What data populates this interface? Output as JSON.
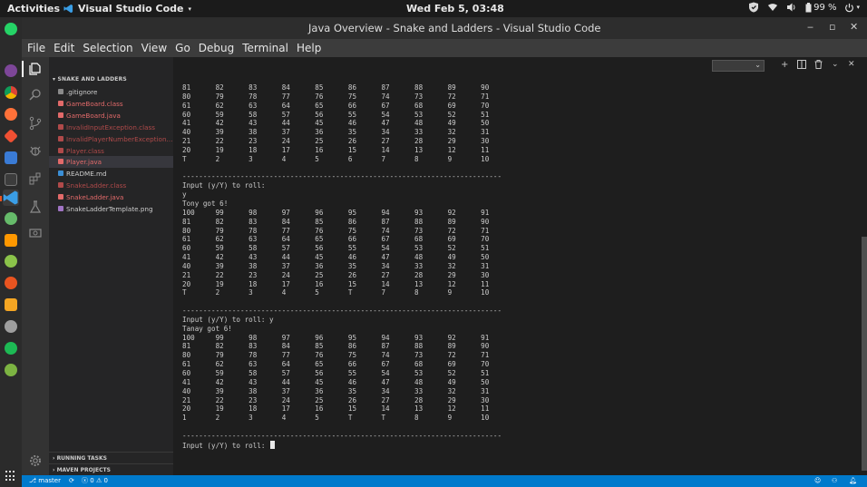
{
  "topbar": {
    "activities": "Activities",
    "app_name": "Visual Studio Code",
    "clock": "Wed Feb  5, 03:48",
    "battery": "99 %",
    "tray_icons": [
      "shield-icon",
      "wifi-icon",
      "volume-icon",
      "battery-icon",
      "power-icon"
    ]
  },
  "window": {
    "title": "Java Overview - Snake and Ladders - Visual Studio Code",
    "controls": [
      "minimize",
      "maximize",
      "close"
    ]
  },
  "menu": [
    "File",
    "Edit",
    "Selection",
    "View",
    "Go",
    "Debug",
    "Terminal",
    "Help"
  ],
  "activity_bar": [
    "explorer-icon",
    "search-icon",
    "source-control-icon",
    "debug-icon",
    "extensions-icon",
    "test-icon",
    "remote-icon",
    "settings-gear-icon"
  ],
  "explorer": {
    "folder": "SNAKE AND LADDERS",
    "files": [
      {
        "name": ".gitignore",
        "color": "#cccccc",
        "icon_color": "#8a8a8a",
        "selected": false
      },
      {
        "name": "GameBoard.class",
        "color": "#e26a6a",
        "icon_color": "#e26a6a",
        "selected": false
      },
      {
        "name": "GameBoard.java",
        "color": "#e26a6a",
        "icon_color": "#e26a6a",
        "selected": false
      },
      {
        "name": "InvalidInputException.class",
        "color": "#b04a4a",
        "icon_color": "#b04a4a",
        "selected": false
      },
      {
        "name": "InvalidPlayerNumberException...",
        "color": "#b04a4a",
        "icon_color": "#b04a4a",
        "selected": false
      },
      {
        "name": "Player.class",
        "color": "#b04a4a",
        "icon_color": "#b04a4a",
        "selected": false
      },
      {
        "name": "Player.java",
        "color": "#e26a6a",
        "icon_color": "#e26a6a",
        "selected": true
      },
      {
        "name": "README.md",
        "color": "#cccccc",
        "icon_color": "#3b8fd6",
        "selected": false
      },
      {
        "name": "SnakeLadder.class",
        "color": "#b04a4a",
        "icon_color": "#b04a4a",
        "selected": false
      },
      {
        "name": "SnakeLadder.java",
        "color": "#e26a6a",
        "icon_color": "#e26a6a",
        "selected": false
      },
      {
        "name": "SnakeLadderTemplate.png",
        "color": "#cccccc",
        "icon_color": "#a074c4",
        "selected": false
      }
    ],
    "sections": [
      "RUNNING TASKS",
      "MAVEN PROJECTS"
    ]
  },
  "panel": {
    "toolbar_icons": [
      "add-terminal-icon",
      "split-terminal-icon",
      "kill-terminal-icon",
      "chevron-up-icon",
      "close-icon"
    ]
  },
  "terminal": {
    "lines": [
      "81      82      83      84      85      86      87      88      89      90",
      "80      79      78      77      76      75      74      73      72      71",
      "61      62      63      64      65      66      67      68      69      70",
      "60      59      58      57      56      55      54      53      52      51",
      "41      42      43      44      45      46      47      48      49      50",
      "40      39      38      37      36      35      34      33      32      31",
      "21      22      23      24      25      26      27      28      29      30",
      "20      19      18      17      16      15      14      13      12      11",
      "T       2       3       4       5       6       7       8       9       10",
      "",
      "-----------------------------------------------------------------------------",
      "Input (y/Y) to roll:",
      "y",
      "Tony got 6!",
      "100     99      98      97      96      95      94      93      92      91",
      "81      82      83      84      85      86      87      88      89      90",
      "80      79      78      77      76      75      74      73      72      71",
      "61      62      63      64      65      66      67      68      69      70",
      "60      59      58      57      56      55      54      53      52      51",
      "41      42      43      44      45      46      47      48      49      50",
      "40      39      38      37      36      35      34      33      32      31",
      "21      22      23      24      25      26      27      28      29      30",
      "20      19      18      17      16      15      14      13      12      11",
      "T       2       3       4       5       T       7       8       9       10",
      "",
      "-----------------------------------------------------------------------------",
      "Input (y/Y) to roll: y",
      "Tanay got 6!",
      "100     99      98      97      96      95      94      93      92      91",
      "81      82      83      84      85      86      87      88      89      90",
      "80      79      78      77      76      75      74      73      72      71",
      "61      62      63      64      65      66      67      68      69      70",
      "60      59      58      57      56      55      54      53      52      51",
      "41      42      43      44      45      46      47      48      49      50",
      "40      39      38      37      36      35      34      33      32      31",
      "21      22      23      24      25      26      27      28      29      30",
      "20      19      18      17      16      15      14      13      12      11",
      "1       2       3       4       5       T       T       8       9       10",
      "",
      "-----------------------------------------------------------------------------"
    ],
    "prompt": "Input (y/Y) to roll: "
  },
  "statusbar": {
    "branch": "master",
    "sync": "⟳",
    "errors": "0",
    "warnings": "0"
  },
  "colors": {
    "status_bar": "#007acc",
    "editor_bg": "#1e1e1e",
    "sidebar_bg": "#252526",
    "activity_bar_bg": "#333333",
    "accent": "#e95420"
  }
}
